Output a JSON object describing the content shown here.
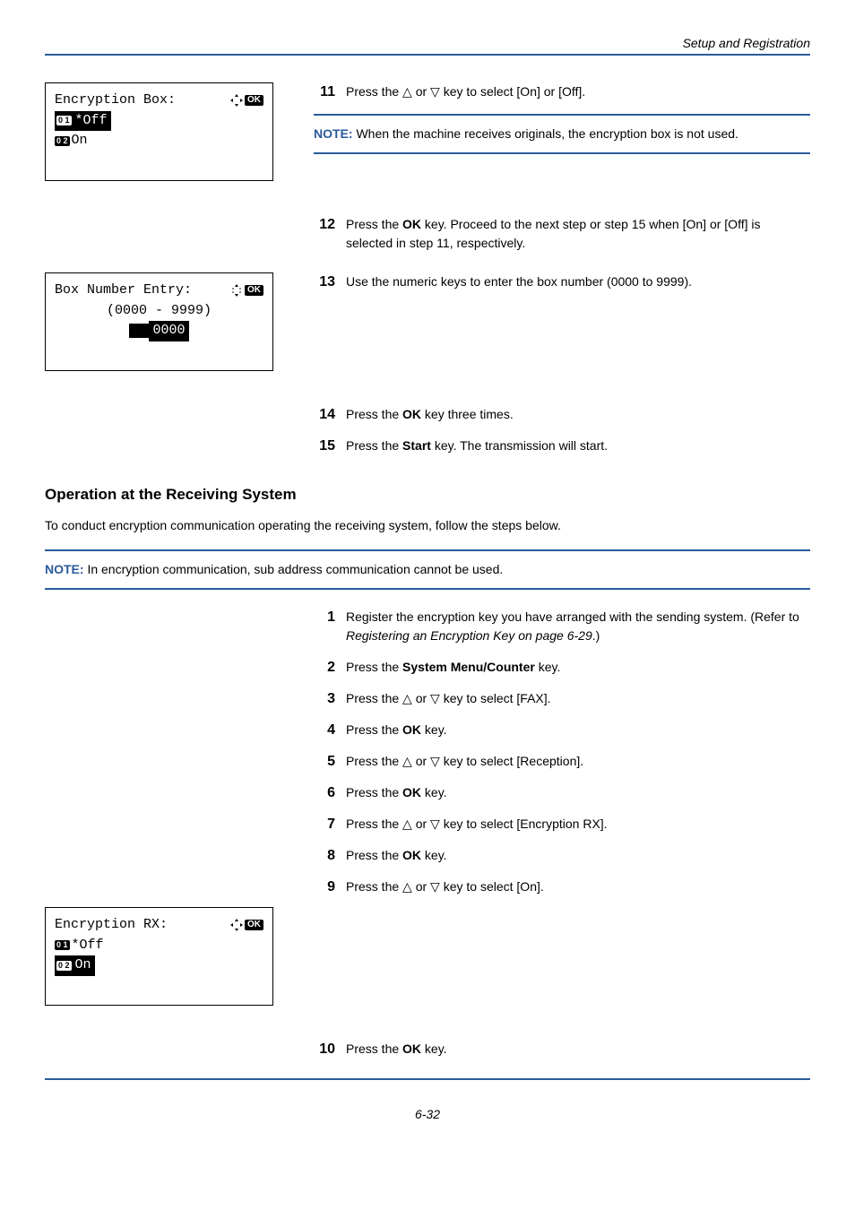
{
  "header": {
    "breadcrumb": "Setup and Registration"
  },
  "lcd1": {
    "title": "Encryption Box:",
    "ok": "OK",
    "opt1_num": "0 1",
    "opt1_label": "*Off",
    "opt2_num": "0 2",
    "opt2_label": "On"
  },
  "step11": {
    "num": "11",
    "text_a": "Press the ",
    "text_b": " or ",
    "text_c": " key to select [On] or [Off]."
  },
  "note1": {
    "label": "NOTE: ",
    "text": "When the machine receives originals, the encryption box is not used."
  },
  "step12": {
    "num": "12",
    "text": "Press the OK key. Proceed to the next step or step 15 when [On] or [Off] is selected in step 11, respectively."
  },
  "step13": {
    "num": "13",
    "text": "Use the numeric keys to enter the box number (0000 to 9999)."
  },
  "lcd2": {
    "title": "Box Number Entry:",
    "ok": "OK",
    "range": "(0000 - 9999)",
    "value": "0000"
  },
  "step14": {
    "num": "14",
    "text_a": "Press the ",
    "bold": "OK",
    "text_b": " key three times."
  },
  "step15": {
    "num": "15",
    "text_a": "Press the ",
    "bold": "Start",
    "text_b": " key. The transmission will start."
  },
  "section": {
    "title": "Operation at the Receiving System"
  },
  "intro": "To conduct encryption communication operating the receiving system, follow the steps below.",
  "note2": {
    "label": "NOTE: ",
    "text": "In encryption communication, sub address communication cannot be used."
  },
  "steps_r": {
    "s1": {
      "num": "1",
      "text_a": "Register the encryption key you have arranged with the sending system. (Refer to ",
      "italic": "Registering an Encryption Key on page 6-29",
      "text_b": ".)"
    },
    "s2": {
      "num": "2",
      "text_a": "Press the ",
      "bold": "System Menu/Counter",
      "text_b": " key."
    },
    "s3": {
      "num": "3",
      "text_a": "Press the ",
      "text_b": " or ",
      "text_c": " key to select [FAX]."
    },
    "s4": {
      "num": "4",
      "text_a": "Press the ",
      "bold": "OK",
      "text_b": " key."
    },
    "s5": {
      "num": "5",
      "text_a": "Press the ",
      "text_b": " or ",
      "text_c": " key to select [Reception]."
    },
    "s6": {
      "num": "6",
      "text_a": "Press the ",
      "bold": "OK",
      "text_b": " key."
    },
    "s7": {
      "num": "7",
      "text_a": "Press the ",
      "text_b": " or ",
      "text_c": " key to select [Encryption RX]."
    },
    "s8": {
      "num": "8",
      "text_a": "Press the ",
      "bold": "OK",
      "text_b": " key."
    },
    "s9": {
      "num": "9",
      "text_a": "Press the ",
      "text_b": " or ",
      "text_c": " key to select [On]."
    }
  },
  "lcd3": {
    "title": "Encryption RX:",
    "ok": "OK",
    "opt1_num": "0 1",
    "opt1_label": "*Off",
    "opt2_num": "0 2",
    "opt2_label": "On"
  },
  "step10b": {
    "num": "10",
    "text_a": "Press the ",
    "bold": "OK",
    "text_b": " key."
  },
  "footer": {
    "page": "6-32"
  }
}
